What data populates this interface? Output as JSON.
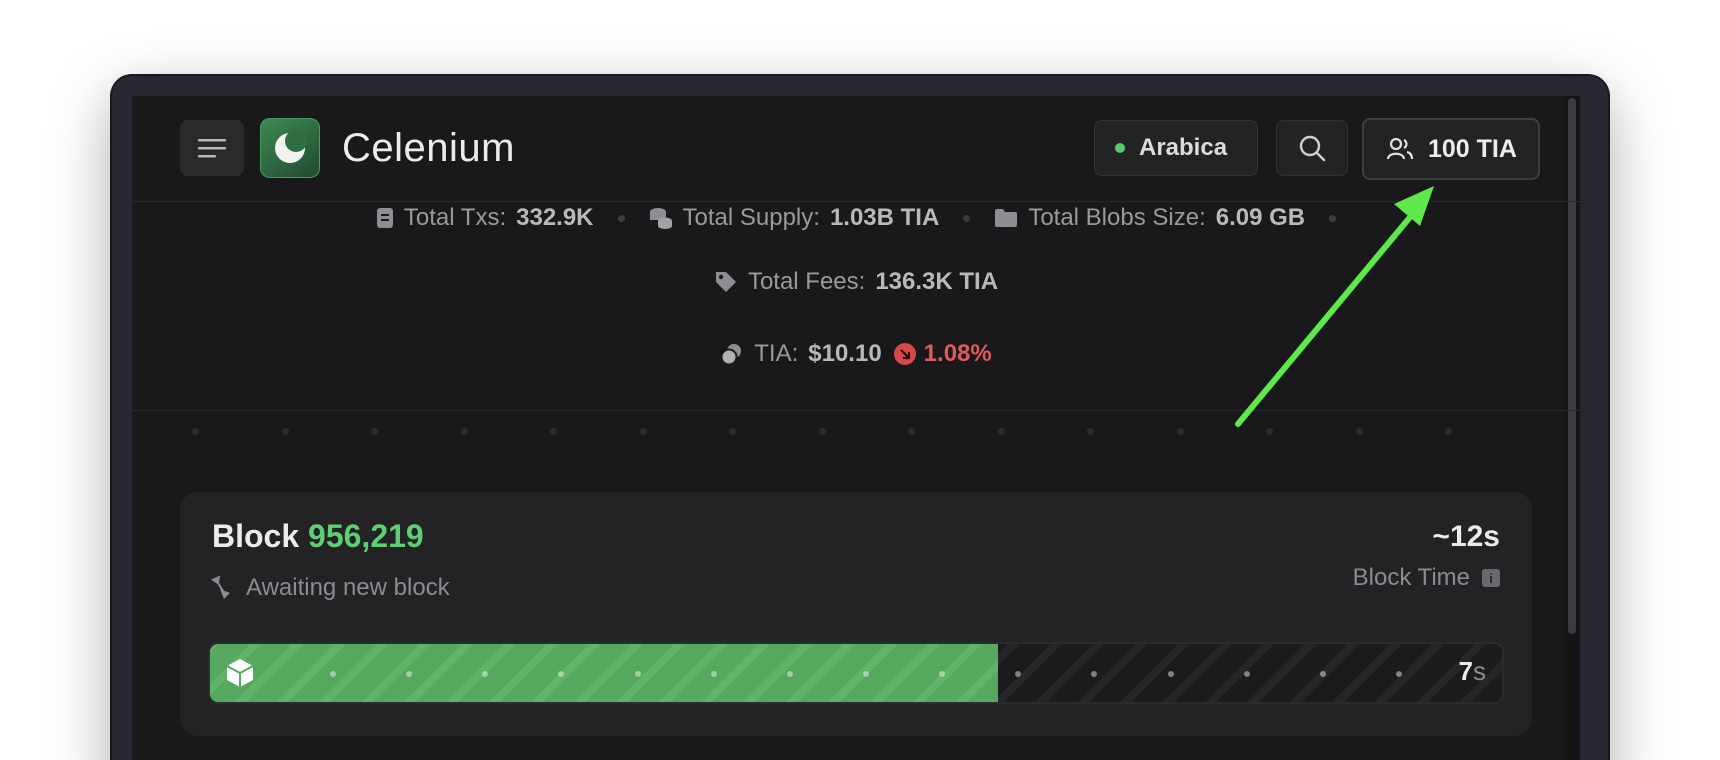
{
  "header": {
    "title": "Celenium",
    "network": "Arabica",
    "account": "100 TIA"
  },
  "stats": {
    "total_txs_label": "Total Txs:",
    "total_txs": "332.9K",
    "total_supply_label": "Total Supply:",
    "total_supply": "1.03B TIA",
    "total_blobs_label": "Total Blobs Size:",
    "total_blobs": "6.09 GB",
    "total_fees_label": "Total Fees:",
    "total_fees": "136.3K TIA",
    "price_label": "TIA:",
    "price": "$10.10",
    "price_change": "1.08%"
  },
  "block": {
    "label": "Block",
    "number": "956,219",
    "status": "Awaiting new block",
    "block_time_value": "~12s",
    "block_time_label": "Block Time",
    "elapsed_value": "7",
    "elapsed_unit": "s",
    "progress_fraction": 0.61
  },
  "colors": {
    "accent_green": "#5fcf75",
    "price_down_red": "#e05a5a",
    "annotation_arrow": "#5ee84a"
  },
  "icons": {
    "menu": "menu-icon",
    "logo": "moon-logo-icon",
    "search": "search-icon",
    "account": "users-icon",
    "txs": "document-icon",
    "supply": "coins-icon",
    "blobs": "folder-icon",
    "fees": "tag-icon",
    "price": "coin-icon",
    "awaiting": "hourglass-icon",
    "block": "cube-icon"
  }
}
